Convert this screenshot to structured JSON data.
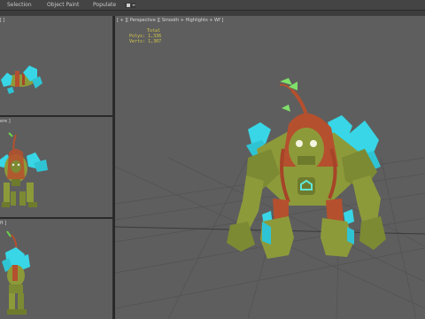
{
  "toolbar": {
    "tabs": [
      {
        "label": "Selection"
      },
      {
        "label": "Object Paint"
      },
      {
        "label": "Populate"
      }
    ]
  },
  "viewports": {
    "top_left": {
      "label": "[ ]"
    },
    "mid_left": {
      "label": "ere ]"
    },
    "bottom_left": {
      "label": "ft ]"
    },
    "main": {
      "label": "[ + ][ Perspective ][ Smooth + Highlights + Wf ]"
    }
  },
  "stats": {
    "header": "Total",
    "polys_label": "Polys:",
    "polys_value": "1,336",
    "verts_label": "Verts:",
    "verts_value": "1,307"
  },
  "colors": {
    "viewport_bg": "#5e5e5e",
    "crystal": "#38d6e6",
    "moss": "#8d9a3a",
    "root": "#b5502e",
    "stats": "#d6c94a"
  }
}
